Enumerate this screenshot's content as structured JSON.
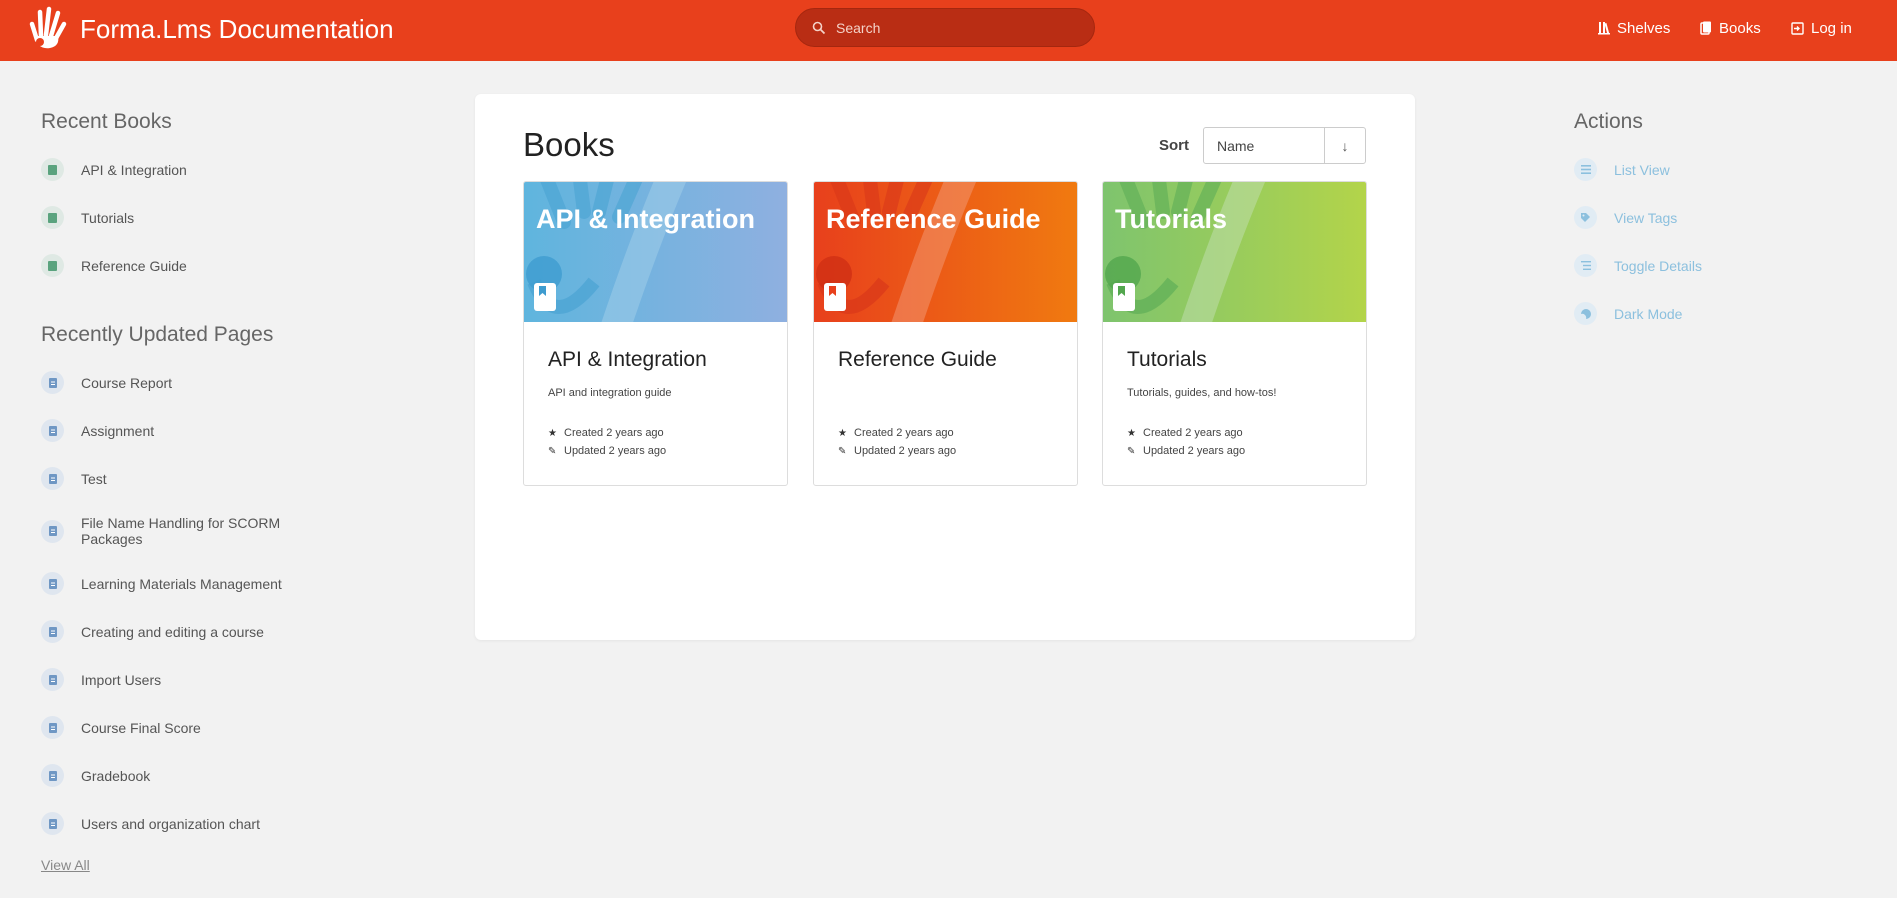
{
  "header": {
    "title": "Forma.Lms Documentation",
    "search_placeholder": "Search",
    "nav": [
      {
        "label": "Shelves",
        "icon": "shelves-icon"
      },
      {
        "label": "Books",
        "icon": "books-icon"
      },
      {
        "label": "Log in",
        "icon": "login-icon"
      }
    ],
    "color": "#e8401c"
  },
  "sidebar": {
    "recent_books_title": "Recent Books",
    "recent_books": [
      "API & Integration",
      "Tutorials",
      "Reference Guide"
    ],
    "recent_pages_title": "Recently Updated Pages",
    "recent_pages": [
      "Course Report",
      "Assignment",
      "Test",
      "File Name Handling for SCORM Packages",
      "Learning Materials Management",
      "Creating and editing a course",
      "Import Users",
      "Course Final Score",
      "Gradebook",
      "Users and organization chart"
    ],
    "view_all": "View All"
  },
  "main": {
    "title": "Books",
    "sort_label": "Sort",
    "sort_value": "Name",
    "sort_direction": "↓",
    "books": [
      {
        "cover_title": "API & Integration",
        "name": "API & Integration",
        "description": "API and integration guide",
        "created": "Created 2 years ago",
        "updated": "Updated 2 years ago",
        "colors": [
          "#5fb5de",
          "#8fb0e0"
        ]
      },
      {
        "cover_title": "Reference Guide",
        "name": "Reference Guide",
        "description": "",
        "created": "Created 2 years ago",
        "updated": "Updated 2 years ago",
        "colors": [
          "#e8401c",
          "#f07a10"
        ]
      },
      {
        "cover_title": "Tutorials",
        "name": "Tutorials",
        "description": "Tutorials, guides, and how-tos!",
        "created": "Created 2 years ago",
        "updated": "Updated 2 years ago",
        "colors": [
          "#7ec46e",
          "#b3d44a"
        ]
      }
    ]
  },
  "actions": {
    "title": "Actions",
    "items": [
      {
        "label": "List View",
        "icon": "list-icon"
      },
      {
        "label": "View Tags",
        "icon": "tag-icon"
      },
      {
        "label": "Toggle Details",
        "icon": "details-icon"
      },
      {
        "label": "Dark Mode",
        "icon": "moon-icon"
      }
    ]
  }
}
